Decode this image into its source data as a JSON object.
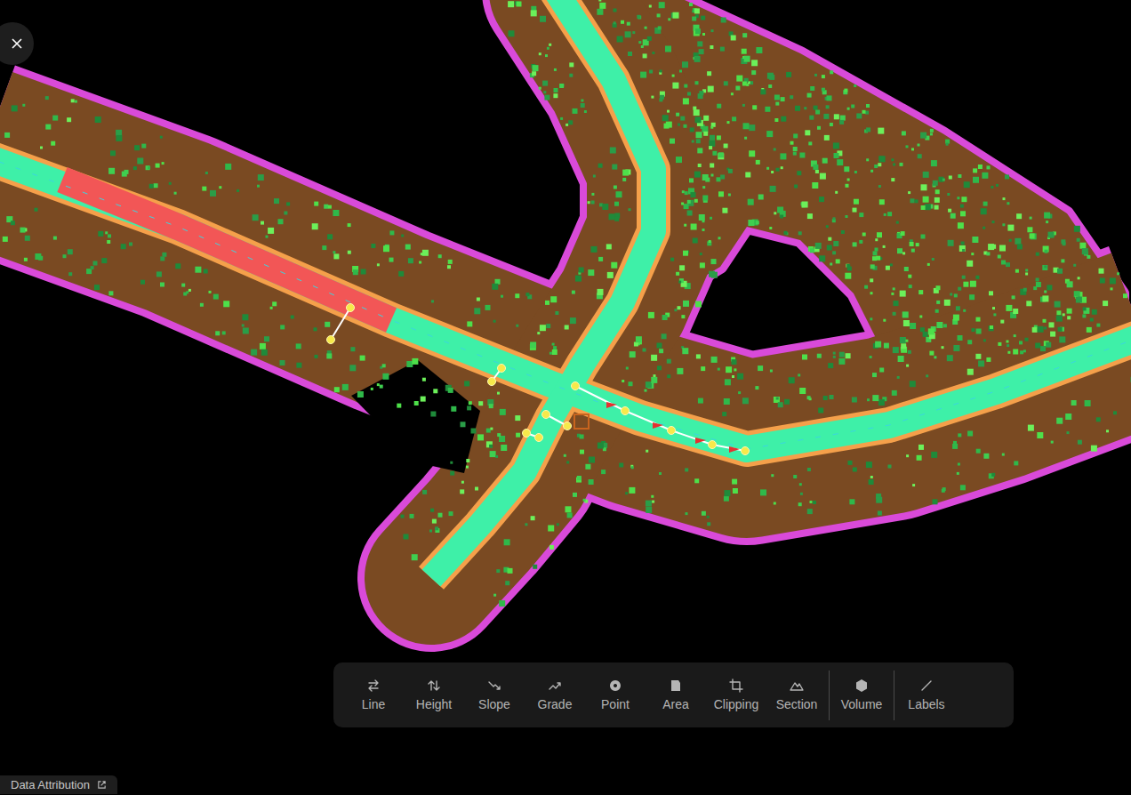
{
  "toolbar": {
    "groups": [
      {
        "tools": [
          {
            "label": "Line"
          },
          {
            "label": "Height"
          },
          {
            "label": "Slope"
          },
          {
            "label": "Grade"
          },
          {
            "label": "Point"
          },
          {
            "label": "Area"
          },
          {
            "label": "Clipping"
          },
          {
            "label": "Section"
          }
        ]
      },
      {
        "tools": [
          {
            "label": "Volume"
          }
        ]
      },
      {
        "tools": [
          {
            "label": "Labels"
          }
        ]
      }
    ]
  },
  "attribution": {
    "label": "Data Attribution"
  }
}
